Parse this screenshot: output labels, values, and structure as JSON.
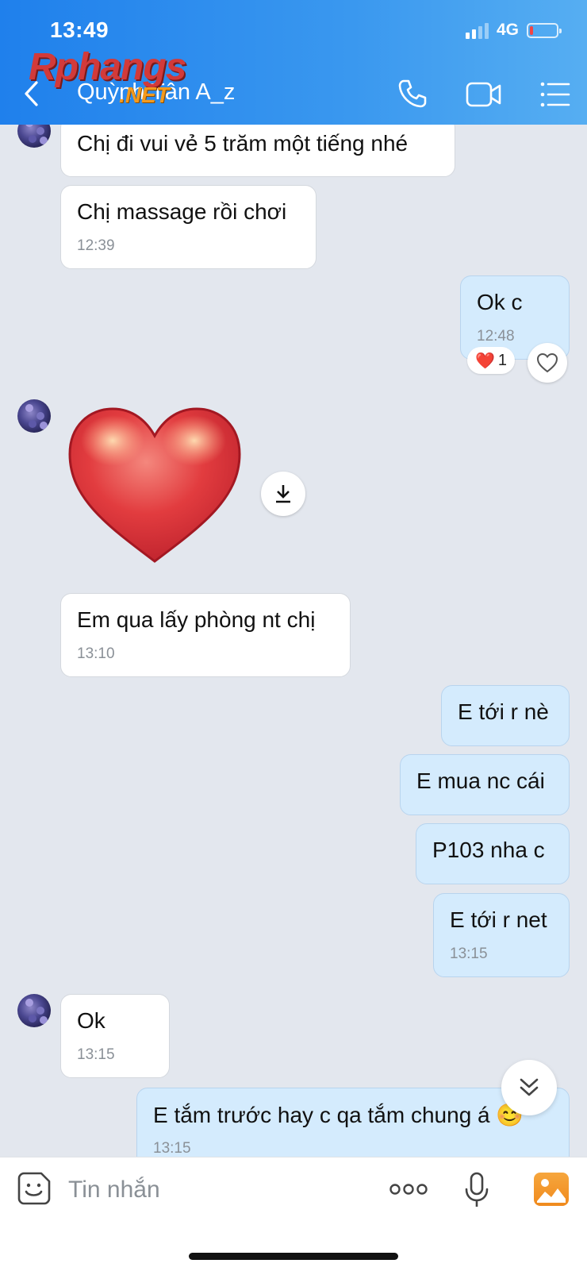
{
  "status": {
    "time": "13:49",
    "network": "4G"
  },
  "header": {
    "title": "Quỳnh Tân A_z"
  },
  "watermark": {
    "brand": "Rphangs",
    "suffix": ".NET"
  },
  "icons": {
    "back": "chevron-left-icon",
    "call": "phone-icon",
    "video": "video-camera-icon",
    "menu": "list-menu-icon",
    "reaction": "heart-icon",
    "download": "download-icon",
    "scroll": "double-chevron-down-icon",
    "sticker": "sticker-smile-icon",
    "more": "more-dots-icon",
    "mic": "microphone-icon",
    "photo": "photo-icon"
  },
  "colors": {
    "header": "#2a8bee",
    "incoming_bubble": "#ffffff",
    "outgoing_bubble": "#d4ebfd",
    "reaction": "#e0242f"
  },
  "messages": [
    {
      "dir": "in",
      "text": "Chị đi vui vẻ 5 trăm một tiếng nhé",
      "time": ""
    },
    {
      "dir": "in",
      "text": "Chị massage rồi chơi",
      "time": "12:39"
    },
    {
      "dir": "out",
      "text": "Ok c",
      "time": "12:48"
    },
    {
      "dir": "in",
      "text": "Em qua lấy phòng nt chị",
      "time": "13:10"
    },
    {
      "dir": "out",
      "text": "E tới r nè",
      "time": ""
    },
    {
      "dir": "out",
      "text": "E mua nc cái",
      "time": ""
    },
    {
      "dir": "out",
      "text": "P103 nha c",
      "time": ""
    },
    {
      "dir": "out",
      "text": "E tới r net",
      "time": "13:15"
    },
    {
      "dir": "in",
      "text": "Ok",
      "time": "13:15"
    },
    {
      "dir": "out",
      "text": "E tắm trước hay c qa tắm chung á 😊",
      "time": "13:15"
    }
  ],
  "reaction": {
    "emoji": "❤️",
    "count": "1"
  },
  "input": {
    "placeholder": "Tin nhắn"
  }
}
